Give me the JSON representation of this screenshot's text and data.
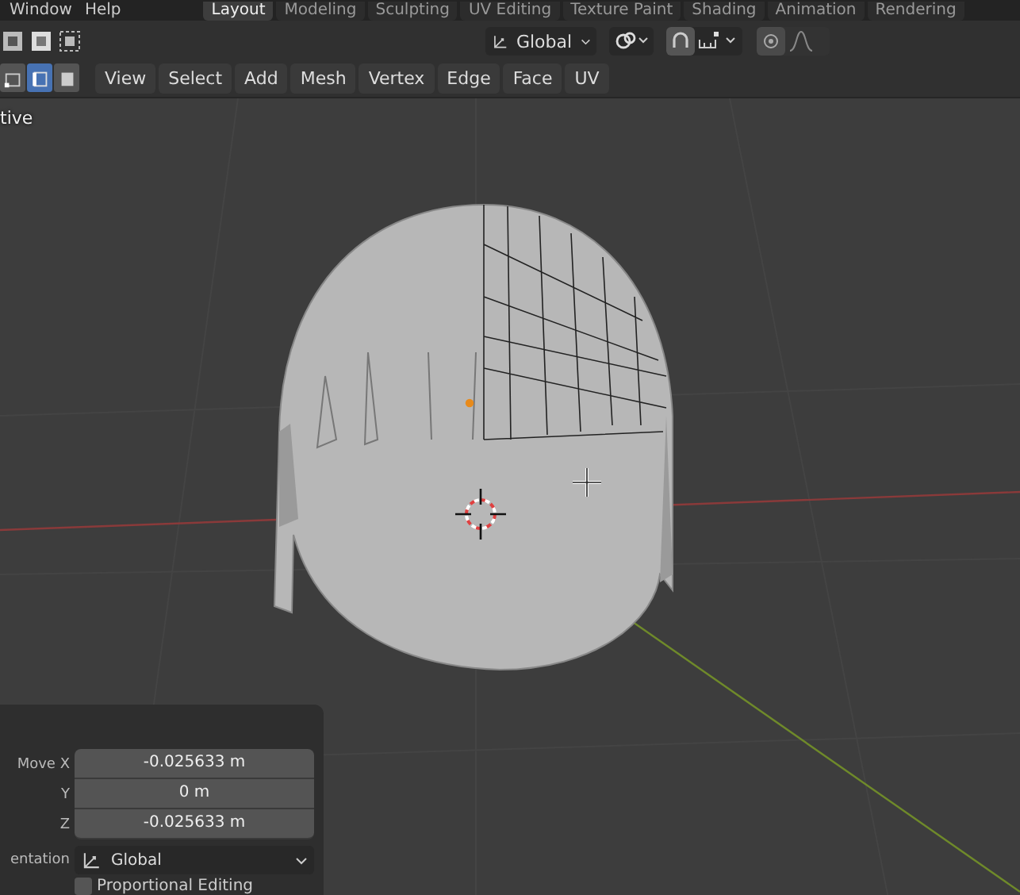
{
  "top_menu": [
    "Window",
    "Help"
  ],
  "workspace_tabs": [
    {
      "label": "Layout",
      "selected": true
    },
    {
      "label": "Modeling",
      "selected": false
    },
    {
      "label": "Sculpting",
      "selected": false
    },
    {
      "label": "UV Editing",
      "selected": false
    },
    {
      "label": "Texture Paint",
      "selected": false
    },
    {
      "label": "Shading",
      "selected": false
    },
    {
      "label": "Animation",
      "selected": false
    },
    {
      "label": "Rendering",
      "selected": false
    }
  ],
  "header": {
    "orientation": "Global"
  },
  "select_modes": [
    {
      "kind": "vertex",
      "selected": false
    },
    {
      "kind": "edge",
      "selected": true
    },
    {
      "kind": "face",
      "selected": false
    }
  ],
  "edit_menus": [
    "View",
    "Select",
    "Add",
    "Mesh",
    "Vertex",
    "Edge",
    "Face",
    "UV"
  ],
  "viewport": {
    "label": "tive"
  },
  "operator_panel": {
    "fields": [
      {
        "label": "Move X",
        "value": "-0.025633 m"
      },
      {
        "label": "Y",
        "value": "0 m"
      },
      {
        "label": "Z",
        "value": "-0.025633 m"
      }
    ],
    "orientation_label": "entation",
    "orientation": "Global",
    "proportional_editing": {
      "label": "Proportional Editing",
      "checked": false
    }
  }
}
